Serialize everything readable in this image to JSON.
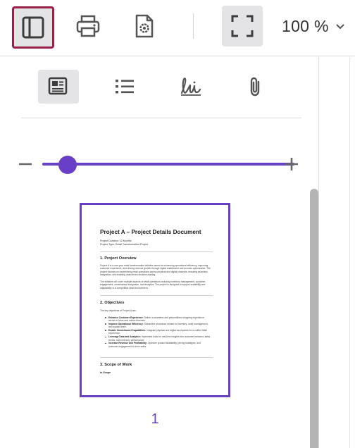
{
  "toolbar": {
    "icons": {
      "sidebar": "sidebar-toggle-icon",
      "print": "printer-icon",
      "document_settings": "document-gear-icon",
      "fullscreen": "fullscreen-icon",
      "zoom_dropdown": "chevron-down-icon"
    },
    "zoom_value": "100 %",
    "active_border_color": "#9a1f47"
  },
  "sidebar": {
    "tabs": [
      {
        "icon": "thumbnails-icon",
        "active": true
      },
      {
        "icon": "outline-list-icon",
        "active": false
      },
      {
        "icon": "signature-icon",
        "active": false
      },
      {
        "icon": "paperclip-icon",
        "active": false
      }
    ],
    "thumbnail_zoom": {
      "minus_icon": "minus-icon",
      "plus_icon": "plus-icon",
      "level": 0.1
    },
    "accent_color": "#6840c7",
    "thumbnails": [
      {
        "page_number": "1",
        "content": {
          "title": "Project A – Project Details Document",
          "duration": "Project Duration: 12 Months",
          "type": "Project Type: Retail Transformation Project",
          "s1_heading": "1. Project Overview",
          "s1_p1": "Project A is a one-year retail transformation initiative aimed at enhancing operational efficiency, improving customer experience, and driving revenue growth through digital enablement and process optimization. The project focuses on modernizing retail operations across physical and digital channels, ensuring seamless integration, and enabling data-driven decision-making.",
          "s1_p2": "The initiative will cover multiple aspects of retail operations including inventory management, customer engagement, omnichannel integration, and analytics. The project is designed to support scalability and adaptability in a competitive retail environment.",
          "s2_heading": "2. Objectives",
          "s2_intro": "The key objectives of Project A are:",
          "objectives": [
            {
              "label": "Enhance Customer Experience:",
              "text": "Deliver a seamless and personalized shopping experience across in-store and online channels."
            },
            {
              "label": "Improve Operational Efficiency:",
              "text": "Streamline processes related to inventory, order management, and supply chain."
            },
            {
              "label": "Enable Omnichannel Capabilities:",
              "text": "Integrate physical and digital touchpoints for a unified retail experience."
            },
            {
              "label": "Leverage Data and Analytics:",
              "text": "Implement tools for real-time insights into customer behavior, sales trends, and inventory performance."
            },
            {
              "label": "Increase Revenue and Profitability:",
              "text": "Optimize product availability, pricing strategies, and customer engagement to drive sales."
            }
          ],
          "s3_heading": "3. Scope of Work",
          "s3_sub": "In-Scope"
        }
      }
    ]
  }
}
